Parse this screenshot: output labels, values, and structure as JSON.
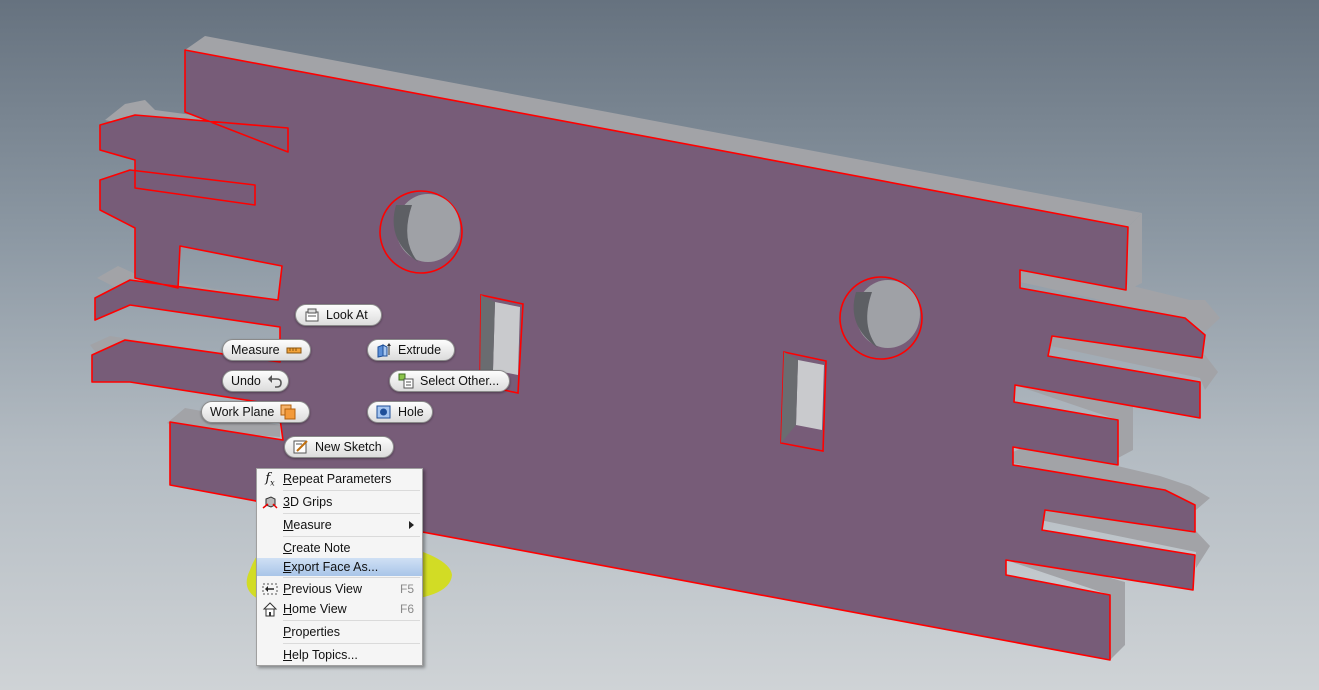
{
  "marking_menu": {
    "look_at": "Look At",
    "measure": "Measure",
    "extrude": "Extrude",
    "undo": "Undo",
    "select_other": "Select Other...",
    "work_plane": "Work Plane",
    "hole": "Hole",
    "new_sketch": "New Sketch"
  },
  "context_menu": {
    "items": [
      {
        "label": "Repeat Parameters",
        "icon": "function-icon",
        "shortcut": ""
      },
      {
        "label": "3D Grips",
        "icon": "grips-icon",
        "shortcut": ""
      },
      {
        "label": "Measure",
        "icon": "",
        "shortcut": "",
        "submenu": true
      },
      {
        "label": "Create Note",
        "icon": "",
        "shortcut": ""
      },
      {
        "label": "Export Face As...",
        "icon": "",
        "shortcut": ""
      },
      {
        "label": "Previous View",
        "icon": "previous-view-icon",
        "shortcut": "F5"
      },
      {
        "label": "Home View",
        "icon": "home-icon",
        "shortcut": "F6"
      },
      {
        "label": "Properties",
        "icon": "",
        "shortcut": ""
      },
      {
        "label": "Help Topics...",
        "icon": "",
        "shortcut": ""
      }
    ]
  },
  "colors": {
    "face": "#775c78",
    "side": "#9ea0a4",
    "edge_highlight": "#ff0000",
    "annotation_marker": "#d6e000"
  }
}
